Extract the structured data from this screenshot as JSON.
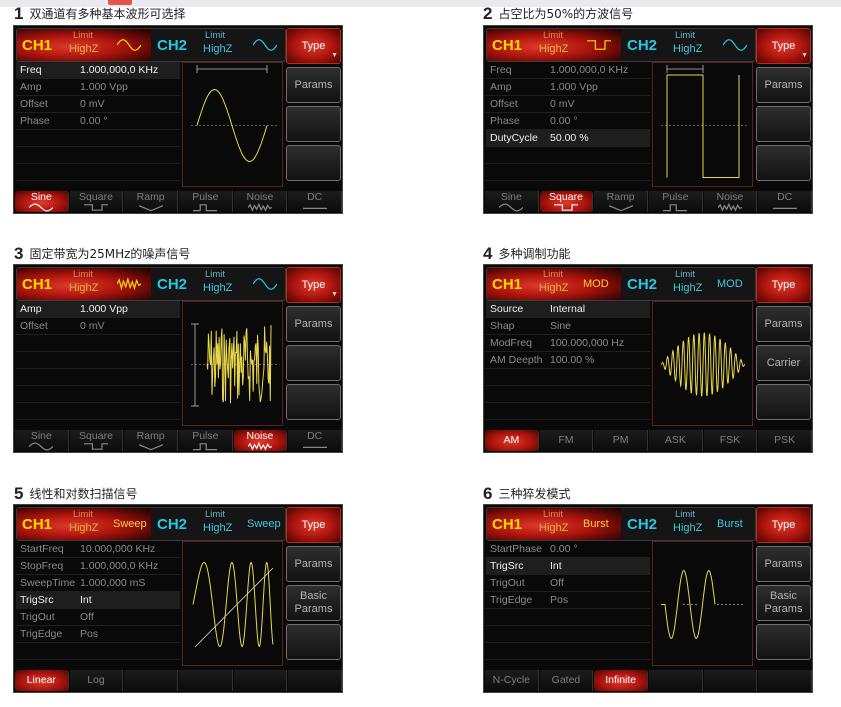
{
  "colors": {
    "ch1": "#ffd800",
    "ch2": "#23c9e5",
    "accent_red": "#c0201a",
    "wave": "#e8d84a"
  },
  "panels": [
    {
      "caption": {
        "num": "1",
        "text": "双通道有多种基本波形可选择"
      },
      "ch1": {
        "label": "CH1",
        "limit": "Limit",
        "highz": "HighZ",
        "mode": "",
        "icon": "sine-icon"
      },
      "ch2": {
        "label": "CH2",
        "limit": "Limit",
        "highz": "HighZ",
        "mode": "",
        "icon": "sine-icon"
      },
      "softkeys": [
        {
          "label": "Type",
          "selected": true,
          "arrow": "▼"
        },
        {
          "label": "Params"
        },
        {
          "label": ""
        },
        {
          "label": ""
        }
      ],
      "params": [
        {
          "name": "Freq",
          "value": "1.000,000,0 KHz",
          "active": true
        },
        {
          "name": "Amp",
          "value": "1.000 Vpp"
        },
        {
          "name": "Offset",
          "value": "0 mV"
        },
        {
          "name": "Phase",
          "value": "0.00 °"
        },
        {
          "name": "",
          "value": ""
        },
        {
          "name": "",
          "value": ""
        },
        {
          "name": "",
          "value": ""
        }
      ],
      "wave": "sine",
      "tabs": [
        {
          "label": "Sine",
          "icon": "sine-icon",
          "selected": true
        },
        {
          "label": "Square",
          "icon": "square-icon"
        },
        {
          "label": "Ramp",
          "icon": "ramp-icon"
        },
        {
          "label": "Pulse",
          "icon": "pulse-icon"
        },
        {
          "label": "Noise",
          "icon": "noise-icon"
        },
        {
          "label": "DC",
          "icon": "dc-icon"
        }
      ]
    },
    {
      "caption": {
        "num": "2",
        "text": "占空比为50%的方波信号"
      },
      "ch1": {
        "label": "CH1",
        "limit": "Limit",
        "highz": "HighZ",
        "mode": "",
        "icon": "square-icon"
      },
      "ch2": {
        "label": "CH2",
        "limit": "Limit",
        "highz": "HighZ",
        "mode": "",
        "icon": "sine-icon"
      },
      "softkeys": [
        {
          "label": "Type",
          "selected": true,
          "arrow": "▼"
        },
        {
          "label": "Params"
        },
        {
          "label": ""
        },
        {
          "label": ""
        }
      ],
      "params": [
        {
          "name": "Freq",
          "value": "1.000,000,0 KHz"
        },
        {
          "name": "Amp",
          "value": "1.000 Vpp"
        },
        {
          "name": "Offset",
          "value": "0 mV"
        },
        {
          "name": "Phase",
          "value": "0.00 °"
        },
        {
          "name": "DutyCycle",
          "value": "50.00 %",
          "active": true
        },
        {
          "name": "",
          "value": ""
        },
        {
          "name": "",
          "value": ""
        }
      ],
      "wave": "square",
      "tabs": [
        {
          "label": "Sine",
          "icon": "sine-icon"
        },
        {
          "label": "Square",
          "icon": "square-icon",
          "selected": true
        },
        {
          "label": "Ramp",
          "icon": "ramp-icon"
        },
        {
          "label": "Pulse",
          "icon": "pulse-icon"
        },
        {
          "label": "Noise",
          "icon": "noise-icon"
        },
        {
          "label": "DC",
          "icon": "dc-icon"
        }
      ]
    },
    {
      "caption": {
        "num": "3",
        "text": "固定带宽为25MHz的噪声信号"
      },
      "ch1": {
        "label": "CH1",
        "limit": "Limit",
        "highz": "HighZ",
        "mode": "",
        "icon": "noise-icon"
      },
      "ch2": {
        "label": "CH2",
        "limit": "Limit",
        "highz": "HighZ",
        "mode": "",
        "icon": "sine-icon"
      },
      "softkeys": [
        {
          "label": "Type",
          "selected": true,
          "arrow": "▼"
        },
        {
          "label": "Params"
        },
        {
          "label": ""
        },
        {
          "label": ""
        }
      ],
      "params": [
        {
          "name": "Amp",
          "value": "1.000 Vpp",
          "active": true
        },
        {
          "name": "Offset",
          "value": "0 mV"
        },
        {
          "name": "",
          "value": ""
        },
        {
          "name": "",
          "value": ""
        },
        {
          "name": "",
          "value": ""
        },
        {
          "name": "",
          "value": ""
        },
        {
          "name": "",
          "value": ""
        }
      ],
      "wave": "noise",
      "tabs": [
        {
          "label": "Sine",
          "icon": "sine-icon"
        },
        {
          "label": "Square",
          "icon": "square-icon"
        },
        {
          "label": "Ramp",
          "icon": "ramp-icon"
        },
        {
          "label": "Pulse",
          "icon": "pulse-icon"
        },
        {
          "label": "Noise",
          "icon": "noise-icon",
          "selected": true
        },
        {
          "label": "DC",
          "icon": "dc-icon"
        }
      ]
    },
    {
      "caption": {
        "num": "4",
        "text": "多种调制功能"
      },
      "ch1": {
        "label": "CH1",
        "limit": "Limit",
        "highz": "HighZ",
        "mode": "MOD",
        "icon": ""
      },
      "ch2": {
        "label": "CH2",
        "limit": "Limit",
        "highz": "HighZ",
        "mode": "MOD",
        "icon": ""
      },
      "softkeys": [
        {
          "label": "Type",
          "selected": true
        },
        {
          "label": "Params"
        },
        {
          "label": "Carrier"
        },
        {
          "label": ""
        }
      ],
      "params": [
        {
          "name": "Source",
          "value": "Internal",
          "active": true
        },
        {
          "name": "Shap",
          "value": "Sine"
        },
        {
          "name": "ModFreq",
          "value": "100.000,000 Hz"
        },
        {
          "name": "AM Deepth",
          "value": "100.00 %"
        },
        {
          "name": "",
          "value": ""
        },
        {
          "name": "",
          "value": ""
        },
        {
          "name": "",
          "value": ""
        }
      ],
      "wave": "am",
      "tabs": [
        {
          "label": "AM",
          "selected": true
        },
        {
          "label": "FM"
        },
        {
          "label": "PM"
        },
        {
          "label": "ASK"
        },
        {
          "label": "FSK"
        },
        {
          "label": "PSK"
        }
      ]
    },
    {
      "caption": {
        "num": "5",
        "text": "线性和对数扫描信号"
      },
      "ch1": {
        "label": "CH1",
        "limit": "Limit",
        "highz": "HighZ",
        "mode": "Sweep",
        "icon": ""
      },
      "ch2": {
        "label": "CH2",
        "limit": "Limit",
        "highz": "HighZ",
        "mode": "Sweep",
        "icon": ""
      },
      "softkeys": [
        {
          "label": "Type",
          "selected": true
        },
        {
          "label": "Params"
        },
        {
          "label": "Basic\nParams"
        },
        {
          "label": ""
        }
      ],
      "params": [
        {
          "name": "StartFreq",
          "value": "10.000,000 KHz"
        },
        {
          "name": "StopFreq",
          "value": "1.000,000,0 KHz"
        },
        {
          "name": "SweepTime",
          "value": "1.000,000 mS"
        },
        {
          "name": "TrigSrc",
          "value": "Int",
          "active": true
        },
        {
          "name": "TrigOut",
          "value": "Off"
        },
        {
          "name": "TrigEdge",
          "value": "Pos"
        },
        {
          "name": "",
          "value": ""
        }
      ],
      "wave": "sweep",
      "tabs": [
        {
          "label": "Linear",
          "selected": true
        },
        {
          "label": "Log"
        },
        {
          "label": ""
        },
        {
          "label": ""
        },
        {
          "label": ""
        },
        {
          "label": ""
        }
      ]
    },
    {
      "caption": {
        "num": "6",
        "text": "三种猝发模式"
      },
      "ch1": {
        "label": "CH1",
        "limit": "Limit",
        "highz": "HighZ",
        "mode": "Burst",
        "icon": ""
      },
      "ch2": {
        "label": "CH2",
        "limit": "Limit",
        "highz": "HighZ",
        "mode": "Burst",
        "icon": ""
      },
      "softkeys": [
        {
          "label": "Type",
          "selected": true
        },
        {
          "label": "Params"
        },
        {
          "label": "Basic\nParams"
        },
        {
          "label": ""
        }
      ],
      "params": [
        {
          "name": "StartPhase",
          "value": "0.00 °"
        },
        {
          "name": "TrigSrc",
          "value": "Int",
          "active": true
        },
        {
          "name": "TrigOut",
          "value": "Off"
        },
        {
          "name": "TrigEdge",
          "value": "Pos"
        },
        {
          "name": "",
          "value": ""
        },
        {
          "name": "",
          "value": ""
        },
        {
          "name": "",
          "value": ""
        }
      ],
      "wave": "burst",
      "tabs": [
        {
          "label": "N-Cycle"
        },
        {
          "label": "Gated"
        },
        {
          "label": "Infinite",
          "selected": true
        },
        {
          "label": ""
        },
        {
          "label": ""
        },
        {
          "label": ""
        }
      ]
    }
  ]
}
